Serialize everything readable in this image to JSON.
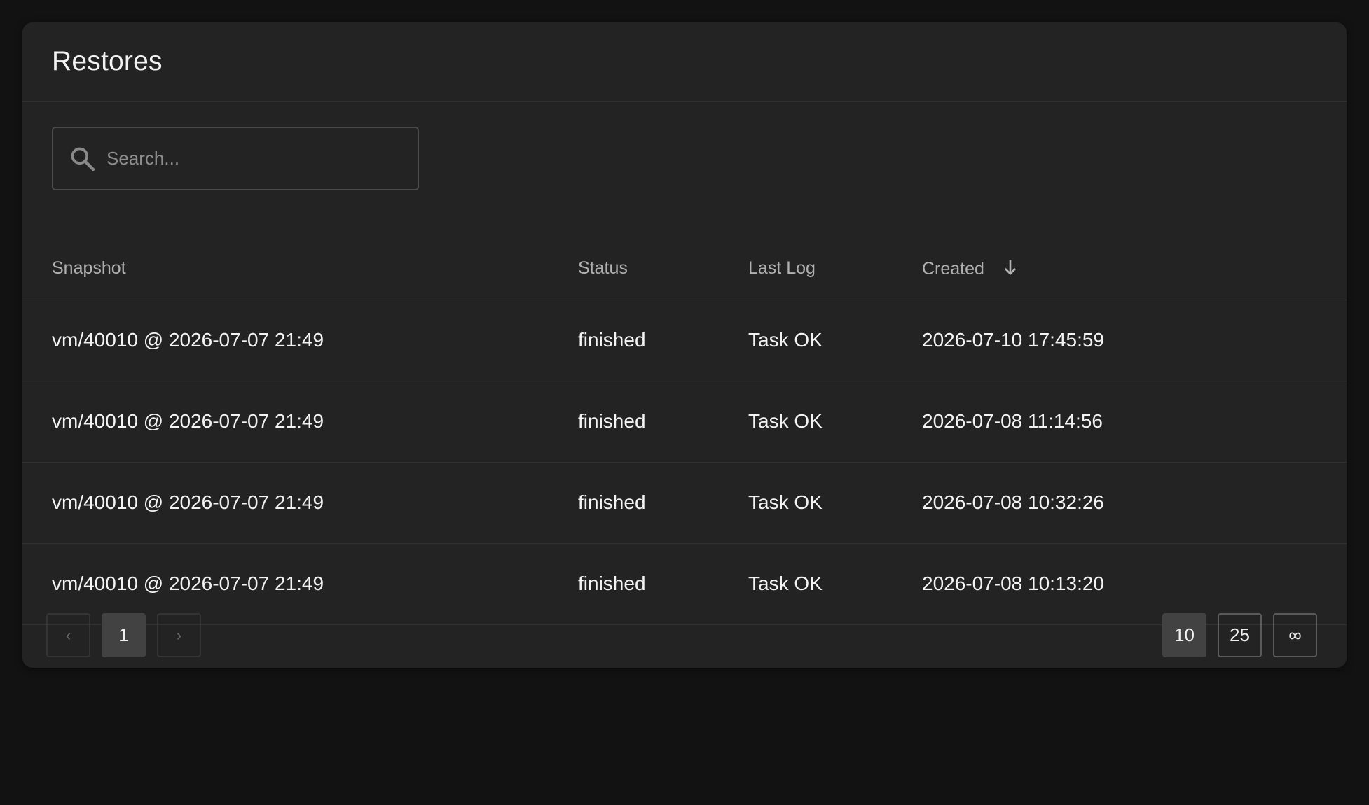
{
  "panel": {
    "title": "Restores"
  },
  "search": {
    "placeholder": "Search...",
    "value": ""
  },
  "table": {
    "columns": {
      "snapshot": "Snapshot",
      "status": "Status",
      "last_log": "Last Log",
      "created": "Created"
    },
    "sort": {
      "column": "created",
      "direction": "descending"
    },
    "rows": [
      {
        "snapshot": "vm/40010 @ 2026-07-07 21:49",
        "status": "finished",
        "last_log": "Task OK",
        "created": "2026-07-10 17:45:59"
      },
      {
        "snapshot": "vm/40010 @ 2026-07-07 21:49",
        "status": "finished",
        "last_log": "Task OK",
        "created": "2026-07-08 11:14:56"
      },
      {
        "snapshot": "vm/40010 @ 2026-07-07 21:49",
        "status": "finished",
        "last_log": "Task OK",
        "created": "2026-07-08 10:32:26"
      },
      {
        "snapshot": "vm/40010 @ 2026-07-07 21:49",
        "status": "finished",
        "last_log": "Task OK",
        "created": "2026-07-08 10:13:20"
      }
    ]
  },
  "pagination": {
    "prev_label": "‹",
    "next_label": "›",
    "current_page": "1",
    "page_sizes": [
      "10",
      "25",
      "∞"
    ],
    "selected_page_size": "10"
  },
  "colors": {
    "background": "#121212",
    "panel": "#232323",
    "divider": "#313131",
    "active_button": "#424242"
  }
}
